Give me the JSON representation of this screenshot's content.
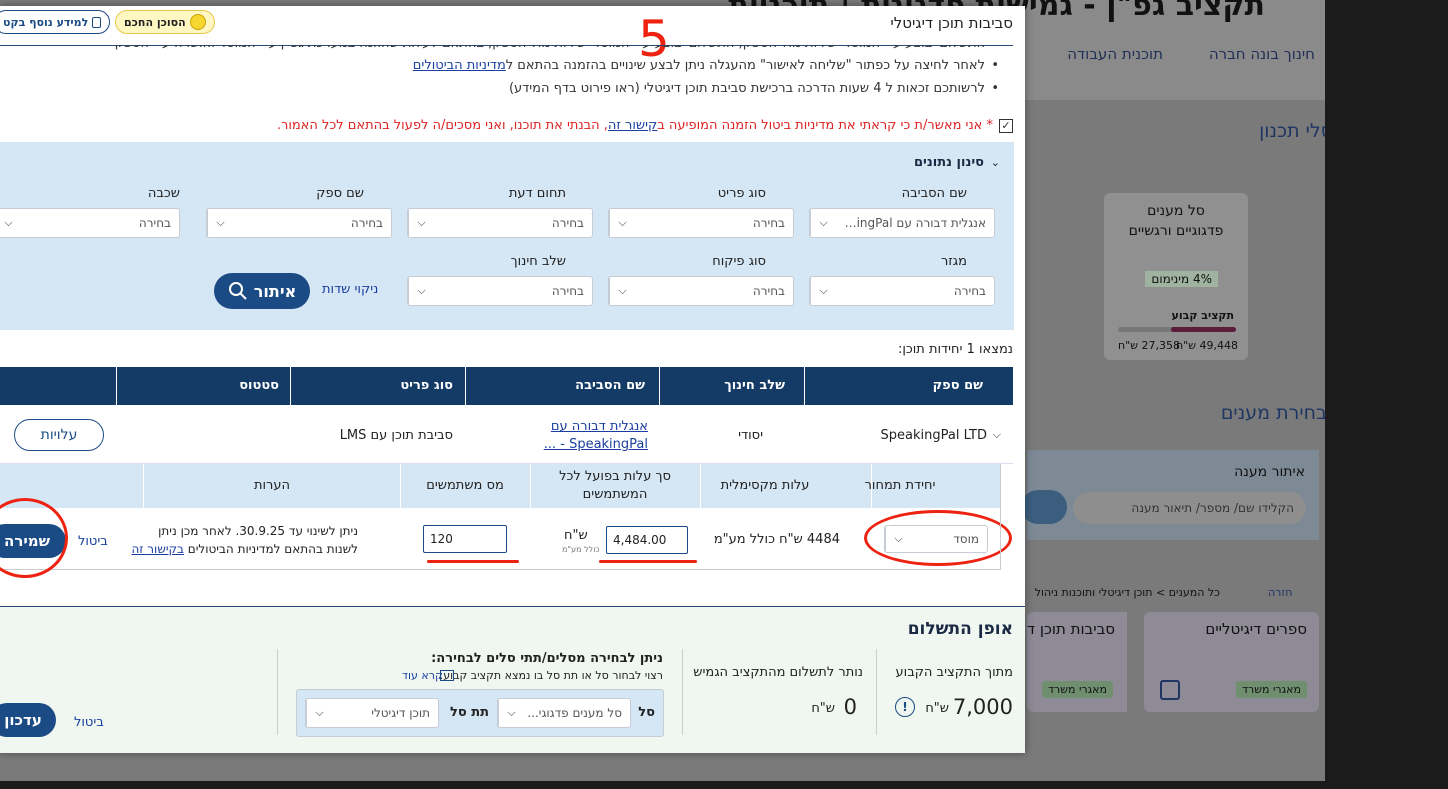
{
  "background": {
    "page_title": "תקציב גפ\"ן - גמישות פדגוגית | תוכניות",
    "nav": [
      "חינוך בונה חברה",
      "תוכנית העבודה"
    ],
    "section_planning": "סלי תכנון",
    "card": {
      "title_line1": "סל מענים",
      "title_line2": "פדגוגיים ורגשיים",
      "percent_label": "4% מינימום",
      "budget_label": "תקציב קבוע",
      "spent": "27,358 ש\"ח",
      "total": "49,448 ש\"ח"
    },
    "section_choice": "בחירת מענים",
    "search_title": "איתור מענה",
    "search_placeholder": "הקלידו שם/ מספר/ תיאור מענה",
    "breadcrumb": "כל המענים > תוכן דיגיטלי ותוכנות ניהול > כלים, סביבות",
    "back_label": "חזרה",
    "cat1": "ספרים דיגיטליים",
    "cat2": "סביבות תוכן ד",
    "tag": "מאגרי משרד"
  },
  "modal": {
    "title": "סביבות תוכן דיגיטלי",
    "pill_agent": "הסוכן החכם",
    "pill_info": "למידע נוסף בקט",
    "bullets": [
      "התשלום יבוצע ע\"י המוסד ישירות מול הספק, התשלום יבוצע ע\"י המוסד ישירות מול הספק, בהתאם לעלות שהוזנה במערכת גפ\"ן ע\"י המוסד ואושרה ע\"י הספק",
      "לאחר לחיצה על כפתור \"שליחה לאישור\" מהעגלה ניתן לבצע שינויים בהזמנה בהתאם ל",
      "לרשותכם זכאות ל 4 שעות הדרכה ברכישת סביבת תוכן דיגיטלי  (ראו פירוט בדף המידע)"
    ],
    "bullet2_link": "מדיניות הביטולים",
    "consent_prefix": "* אני מאשר/ת כי קראתי את מדיניות ביטול הזמנה המופיעה ב",
    "consent_link": "קישור זה",
    "consent_suffix": ", הבנתי את תוכנו, ואני מסכים/ה לפעול בהתאם לכל האמור.",
    "annotation_number": "5"
  },
  "filter": {
    "title": "סינון נתונים",
    "fields": [
      {
        "label": "שם הסביבה",
        "value": "אנגלית דבורה עם SpeakingPal..."
      },
      {
        "label": "סוג פריט",
        "value": "בחירה"
      },
      {
        "label": "תחום דעת",
        "value": "בחירה"
      },
      {
        "label": "שם ספק",
        "value": "בחירה"
      },
      {
        "label": "שכבה",
        "value": "בחירה"
      },
      {
        "label": "מגזר",
        "value": "בחירה"
      },
      {
        "label": "סוג פיקוח",
        "value": "בחירה"
      },
      {
        "label": "שלב חינוך",
        "value": "בחירה"
      }
    ],
    "search_button": "איתור",
    "clear_button": "ניקוי שדות"
  },
  "results": {
    "found_text": "נמצאו 1 יחידות תוכן:",
    "columns": [
      "שם ספק",
      "שלב חינוך",
      "שם הסביבה",
      "סוג פריט",
      "סטטוס"
    ],
    "row": {
      "supplier": "SpeakingPal LTD",
      "stage": "יסודי",
      "env_name": "אנגלית דבורה עם SpeakingPal - ...",
      "type": "סביבת תוכן עם LMS",
      "costs_button": "עלויות"
    }
  },
  "pricing": {
    "columns": [
      "יחידת תמחור",
      "עלות מקסימלית",
      "סך עלות בפועל לכל המשתמשים",
      "מס משתמשים",
      "הערות"
    ],
    "unit_value": "מוסד",
    "max_cost": "4484 ש\"ח כולל מע\"מ",
    "actual_cost": "4,484.00",
    "currency": "ש\"ח",
    "incl_vat": "כולל מע\"מ",
    "users": "120",
    "note_text": "ניתן לשינוי עד 30.9.25. לאחר מכן ניתן לשנות בהתאם למדיניות הביטולים ",
    "note_link": "בקישור זה",
    "cancel_label": "ביטול",
    "save_label": "שמירה"
  },
  "payment": {
    "title": "אופן התשלום",
    "fixed_label": "מתוך התקציב הקבוע",
    "fixed_value": "7,000",
    "fixed_currency": "ש\"ח",
    "flex_label": "נותר לתשלום מהתקציב הגמיש",
    "flex_value": "0",
    "flex_currency": "ש\"ח",
    "basket_title": "ניתן לבחירה מסלים/תתי סלים לבחירה:",
    "basket_sub": "רצוי לבחור סל או תת סל בו נמצא תקציב קבוע.",
    "read_more": "קרא עוד",
    "basket_label": "סל",
    "basket_value": "סל מענים פדגוגי...",
    "sub_label": "תת סל",
    "sub_value": "תוכן דיגיטלי",
    "cancel_label": "ביטול",
    "update_label": "עדכון"
  }
}
